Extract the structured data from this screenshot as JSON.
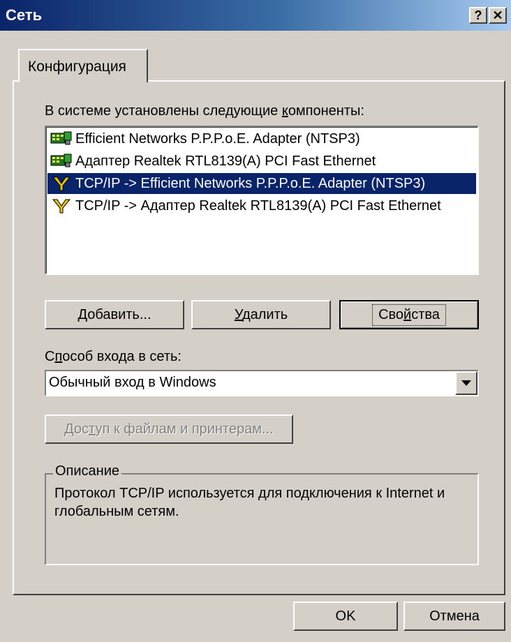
{
  "window": {
    "title": "Сеть",
    "help_button": "?",
    "close_button": "✕"
  },
  "tab": {
    "label": "Конфигурация"
  },
  "components": {
    "label_pre": "В системе установлены следующие ",
    "label_ul": "к",
    "label_post": "омпоненты:",
    "items": [
      {
        "label": "Efficient Networks P.P.P.o.E. Adapter (NTSP3)",
        "icon": "network-adapter-icon",
        "selected": false
      },
      {
        "label": "Адаптер Realtek RTL8139(A) PCI Fast Ethernet",
        "icon": "network-adapter-icon",
        "selected": false
      },
      {
        "label": "TCP/IP -> Efficient Networks P.P.P.o.E. Adapter (NTSP3)",
        "icon": "protocol-icon",
        "selected": true
      },
      {
        "label": "TCP/IP -> Адаптер Realtek RTL8139(A) PCI Fast Ethernet",
        "icon": "protocol-icon",
        "selected": false
      }
    ]
  },
  "buttons": {
    "add_ul": "Д",
    "add_rest": "обавить...",
    "remove_ul": "У",
    "remove_rest": "далить",
    "props_pre": "Сво",
    "props_ul": "й",
    "props_post": "ства",
    "sharing_pre": "Дос",
    "sharing_ul": "т",
    "sharing_post": "уп к файлам и принтерам...",
    "ok": "OK",
    "cancel": "Отмена"
  },
  "logon": {
    "label_pre": "С",
    "label_ul": "п",
    "label_post": "особ входа в сеть:",
    "value": "Обычный вход в Windows"
  },
  "description": {
    "legend": "Описание",
    "text": "Протокол TCP/IP используется для подключения к Internet и глобальным сетям."
  }
}
